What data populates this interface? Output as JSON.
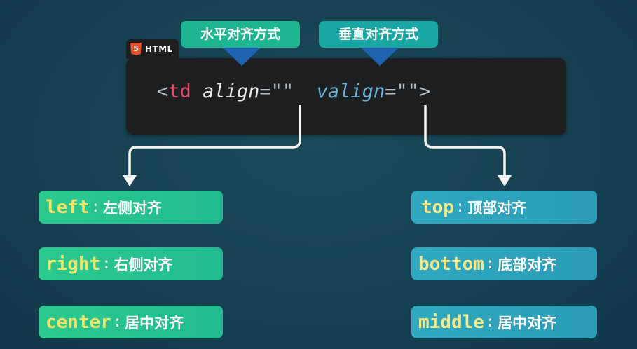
{
  "callouts": {
    "horizontal": "水平对齐方式",
    "vertical": "垂直对齐方式"
  },
  "badge": {
    "icon_glyph": "5",
    "icon": "html5-icon",
    "label": "HTML"
  },
  "code": {
    "open": "<",
    "tag": "td",
    "attr1": "align",
    "eq1": "=\"\"",
    "attr2": "valign",
    "eq2": "=\"\"",
    "close": ">"
  },
  "align_options": [
    {
      "keyword": "left",
      "colon": ":",
      "desc": "左侧对齐"
    },
    {
      "keyword": "right",
      "colon": ":",
      "desc": "右侧对齐"
    },
    {
      "keyword": "center",
      "colon": ":",
      "desc": "居中对齐"
    }
  ],
  "valign_options": [
    {
      "keyword": "top",
      "colon": ":",
      "desc": "顶部对齐"
    },
    {
      "keyword": "bottom",
      "colon": ":",
      "desc": "底部对齐"
    },
    {
      "keyword": "middle",
      "colon": ":",
      "desc": "居中对齐"
    }
  ],
  "colors": {
    "background": "#154050",
    "code_bg": "#1d1f21",
    "callout_h": "#1fb593",
    "callout_v": "#1aa6a2",
    "pointer": "#1f63b0",
    "tag": "#e5496f",
    "attr_valign": "#6ab0d8",
    "keyword": "#f2e36a"
  }
}
